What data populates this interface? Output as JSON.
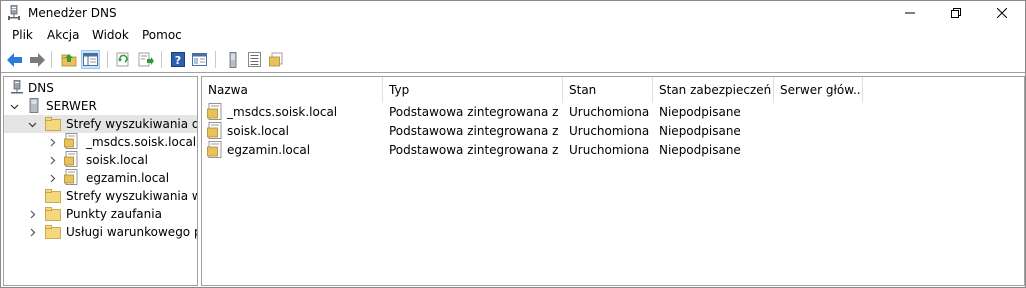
{
  "window": {
    "title": "Menedżer DNS",
    "app_icon": "dns-manager-icon"
  },
  "menu": {
    "items": [
      "Plik",
      "Akcja",
      "Widok",
      "Pomoc"
    ]
  },
  "toolbar": {
    "buttons": [
      "back-icon",
      "forward-icon",
      "up-folder-icon",
      "show-hide-tree-icon",
      "refresh-icon",
      "export-list-icon",
      "help-icon",
      "properties-icon",
      "server-icon",
      "list-icon",
      "folder-properties-icon"
    ]
  },
  "tree": {
    "root": "DNS",
    "server": "SERWER",
    "forward_zones": "Strefy wyszukiwania do p",
    "zones": [
      "_msdcs.soisk.local",
      "soisk.local",
      "egzamin.local"
    ],
    "reverse_zones": "Strefy wyszukiwania wste",
    "trust_points": "Punkty zaufania",
    "conditional_forwarders": "Usługi warunkowego prz"
  },
  "list": {
    "columns": [
      "Nazwa",
      "Typ",
      "Stan",
      "Stan zabezpieczeń ...",
      "Serwer głów..."
    ],
    "rows": [
      {
        "name": "_msdcs.soisk.local",
        "type": "Podstawowa zintegrowana z u...",
        "status": "Uruchomiona",
        "security": "Niepodpisane",
        "master": ""
      },
      {
        "name": "soisk.local",
        "type": "Podstawowa zintegrowana z u...",
        "status": "Uruchomiona",
        "security": "Niepodpisane",
        "master": ""
      },
      {
        "name": "egzamin.local",
        "type": "Podstawowa zintegrowana z u...",
        "status": "Uruchomiona",
        "security": "Niepodpisane",
        "master": ""
      }
    ]
  },
  "colors": {
    "accent_arrow": "#2b79d9",
    "selection": "#e5e5e5",
    "toolbar_active": "#cce4f7",
    "folder": "#e8c25b"
  }
}
